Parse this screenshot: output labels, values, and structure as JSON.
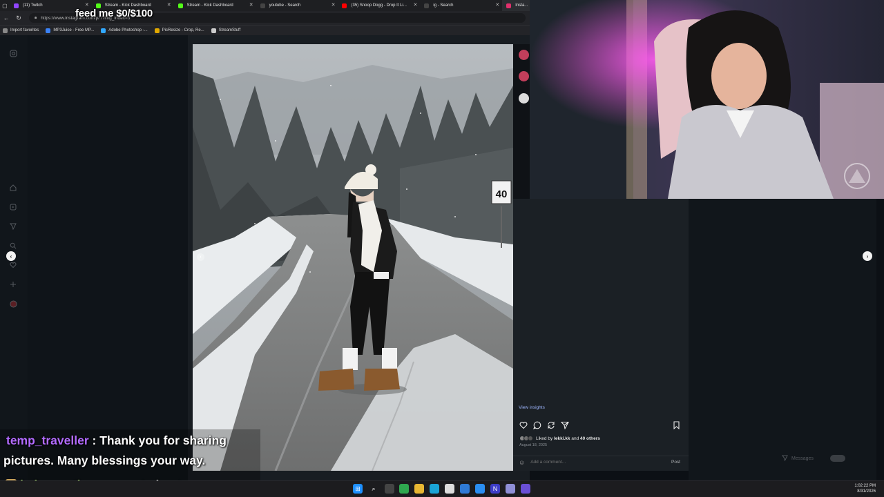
{
  "overlay": {
    "goal_text": "feed me $0/$100"
  },
  "browser": {
    "tabs": [
      {
        "label": "(11) Twitch",
        "color": "#9146ff",
        "active": false
      },
      {
        "label": "Stream - Kick Dashboard",
        "color": "#53fc18",
        "active": false
      },
      {
        "label": "Stream - Kick Dashboard",
        "color": "#53fc18",
        "active": false
      },
      {
        "label": "youtube - Search",
        "color": "#444444",
        "active": false
      },
      {
        "label": "(35) Snoop Dogg - Drop It Li...",
        "color": "#ff0000",
        "active": false
      },
      {
        "label": "ig - Search",
        "color": "#444444",
        "active": false
      },
      {
        "label": "Insta...",
        "color": "#e1306c",
        "active": true
      }
    ],
    "url": "https://www.instagram.com/p/ /?img_index=3",
    "bookmarks": [
      {
        "label": "Import favorites",
        "color": "#888888"
      },
      {
        "label": "MP3Juice - Free MP...",
        "color": "#3b82f6"
      },
      {
        "label": "Adobe Photoshop -...",
        "color": "#31a8ff"
      },
      {
        "label": "PicResize - Crop, Re...",
        "color": "#e0a800"
      },
      {
        "label": "StreamStuff",
        "color": "#cccccc"
      }
    ]
  },
  "post": {
    "view_insights": "View insights",
    "liked_by_prefix": "Liked by",
    "liked_by_user": "lekki.kk",
    "liked_by_and": "and",
    "liked_by_others": "40 others",
    "date": "August 18, 2025",
    "comment_placeholder": "Add a comment...",
    "post_label": "Post",
    "speed_sign": "40"
  },
  "messages": {
    "label": "Messages"
  },
  "chat": [
    {
      "user": "temp_traveller",
      "sep": " : ",
      "text_line1": "Thank you for sharing",
      "text_line2": "pictures. Many blessings your way."
    },
    {
      "user": "kobra_action",
      "sep": " : ",
      "text_line1": "come to boston"
    }
  ],
  "taskbar": {
    "time": "1:02:22 PM",
    "date": "8/31/2026"
  },
  "icons": {
    "heart": "heart-icon",
    "comment": "comment-icon",
    "repost": "repost-icon",
    "share": "share-icon",
    "bookmark": "bookmark-icon"
  }
}
